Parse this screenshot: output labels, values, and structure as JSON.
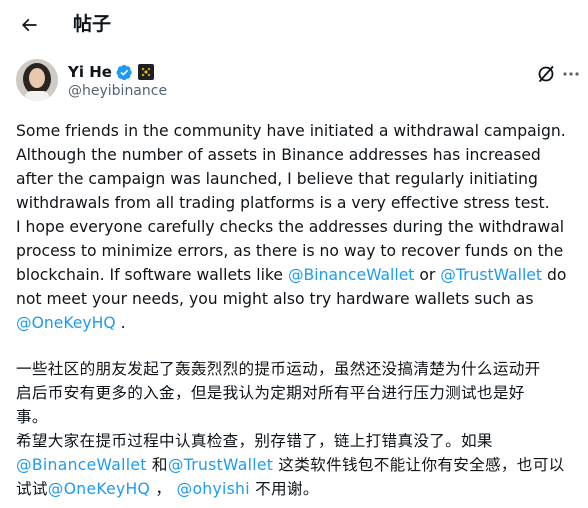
{
  "header": {
    "title": "帖子",
    "back_icon": "arrow-left-icon"
  },
  "author": {
    "name": "Yi He",
    "handle": "@heyibinance",
    "verified_icon": "verified-badge-icon",
    "affiliation_icon": "binance-logo-icon",
    "badge_color": "#1d9bf0",
    "affiliation_color": "#f0b90b"
  },
  "actions": {
    "grok_icon": "grok-icon",
    "more_icon": "more-dots-icon"
  },
  "post": {
    "en": {
      "l1": "Some friends in the community have initiated a withdrawal campaign.",
      "l2": "Although the number of assets  in Binance addresses has increased",
      "l3": "after the campaign was launched, I believe that regularly initiating",
      "l4": "withdrawals from all trading platforms is a very effective stress test.",
      "l5": " I hope everyone carefully checks the addresses during the withdrawal",
      "l6": "process to minimize errors, as there is no way to recover funds on the",
      "l7a": "blockchain. If software wallets like ",
      "l7m1": "@BinanceWallet",
      "l7b": " or ",
      "l7m2": "@TrustWallet",
      "l7c": " do",
      "l8": "not meet your needs, you might also try hardware wallets such as",
      "l9m": "@OneKeyHQ",
      "l9b": " ."
    },
    "cn": {
      "l1": "一些社区的朋友发起了轰轰烈烈的提币运动，虽然还没搞清楚为什么运动开",
      "l2": "启后币安有更多的入金，但是我认为定期对所有平台进行压力测试也是好",
      "l3": "事。",
      "l4": "希望大家在提币过程中认真检查，别存错了，链上打错真没了。如果",
      "l5m1": "@BinanceWallet",
      "l5a": " 和",
      "l5m2": "@TrustWallet",
      "l5b": " 这类软件钱包不能让你有安全感，也可以",
      "l6a": "试试",
      "l6m1": "@OneKeyHQ",
      "l6b": " ， ",
      "l6m2": "@ohyishi",
      "l6c": " 不用谢。"
    },
    "mention_color": "#1d9bf0"
  }
}
